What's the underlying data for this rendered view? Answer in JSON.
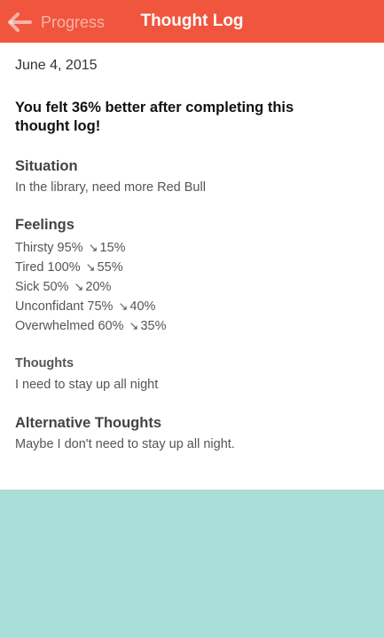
{
  "nav": {
    "back_label": "Progress",
    "title": "Thought Log",
    "accent_color": "#f0563d"
  },
  "log": {
    "date": "June 4, 2015",
    "headline": "You felt 36% better after completing this thought log!",
    "situation": {
      "title": "Situation",
      "text": "In the library, need more Red Bull"
    },
    "feelings": {
      "title": "Feelings",
      "trend_icon": "trending-down-icon",
      "items": [
        {
          "name": "Thirsty",
          "before": "95%",
          "after": "15%"
        },
        {
          "name": "Tired",
          "before": "100%",
          "after": "55%"
        },
        {
          "name": "Sick",
          "before": "50%",
          "after": "20%"
        },
        {
          "name": "Unconfidant",
          "before": "75%",
          "after": "40%"
        },
        {
          "name": "Overwhelmed",
          "before": "60%",
          "after": "35%"
        }
      ]
    },
    "thoughts": {
      "title": "Thoughts",
      "text": "I need to stay up all night"
    },
    "alternative_thoughts": {
      "title": "Alternative Thoughts",
      "text": "Maybe I don't need to stay up all night."
    }
  },
  "background_color": "#aaded8"
}
